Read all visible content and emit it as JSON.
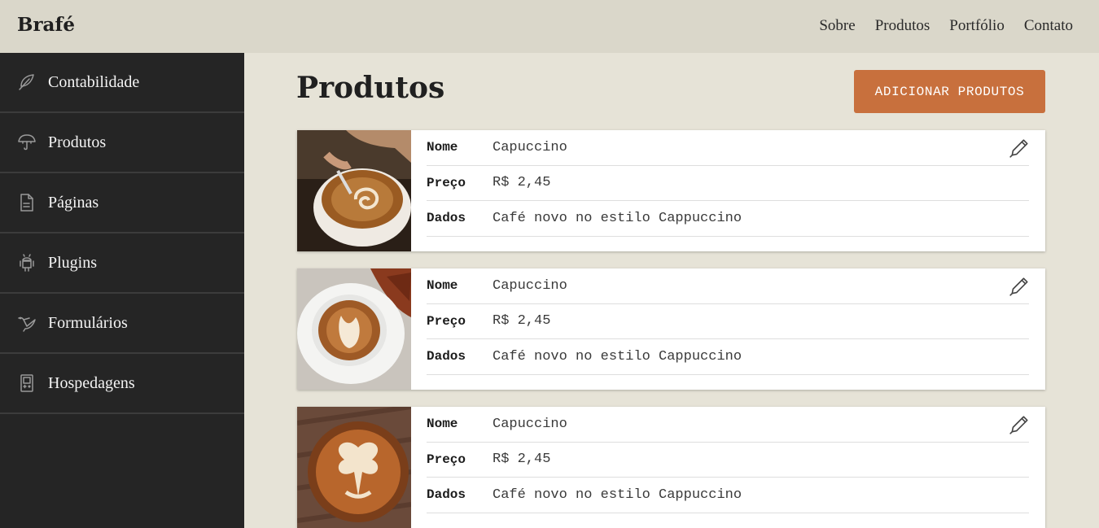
{
  "brand": "Brafé",
  "topnav": [
    "Sobre",
    "Produtos",
    "Portfólio",
    "Contato"
  ],
  "sidebar": {
    "items": [
      {
        "label": "Contabilidade",
        "icon": "feather-icon"
      },
      {
        "label": "Produtos",
        "icon": "umbrella-icon"
      },
      {
        "label": "Páginas",
        "icon": "document-icon"
      },
      {
        "label": "Plugins",
        "icon": "android-icon"
      },
      {
        "label": "Formulários",
        "icon": "bird-icon"
      },
      {
        "label": "Hospedagens",
        "icon": "gameboy-icon"
      }
    ]
  },
  "main": {
    "title": "Produtos",
    "add_button": "ADICIONAR PRODUTOS",
    "products": [
      {
        "fields": [
          {
            "key": "Nome",
            "value": "Capuccino"
          },
          {
            "key": "Preço",
            "value": "R$ 2,45"
          },
          {
            "key": "Dados",
            "value": "Café novo no estilo Cappuccino"
          }
        ]
      },
      {
        "fields": [
          {
            "key": "Nome",
            "value": "Capuccino"
          },
          {
            "key": "Preço",
            "value": "R$ 2,45"
          },
          {
            "key": "Dados",
            "value": "Café novo no estilo Cappuccino"
          }
        ]
      },
      {
        "fields": [
          {
            "key": "Nome",
            "value": "Capuccino"
          },
          {
            "key": "Preço",
            "value": "R$ 2,45"
          },
          {
            "key": "Dados",
            "value": "Café novo no estilo Cappuccino"
          }
        ]
      }
    ]
  },
  "colors": {
    "topbar": "#dad7ca",
    "sidebar": "#252525",
    "background": "#e6e3d7",
    "accent": "#c8703d"
  }
}
